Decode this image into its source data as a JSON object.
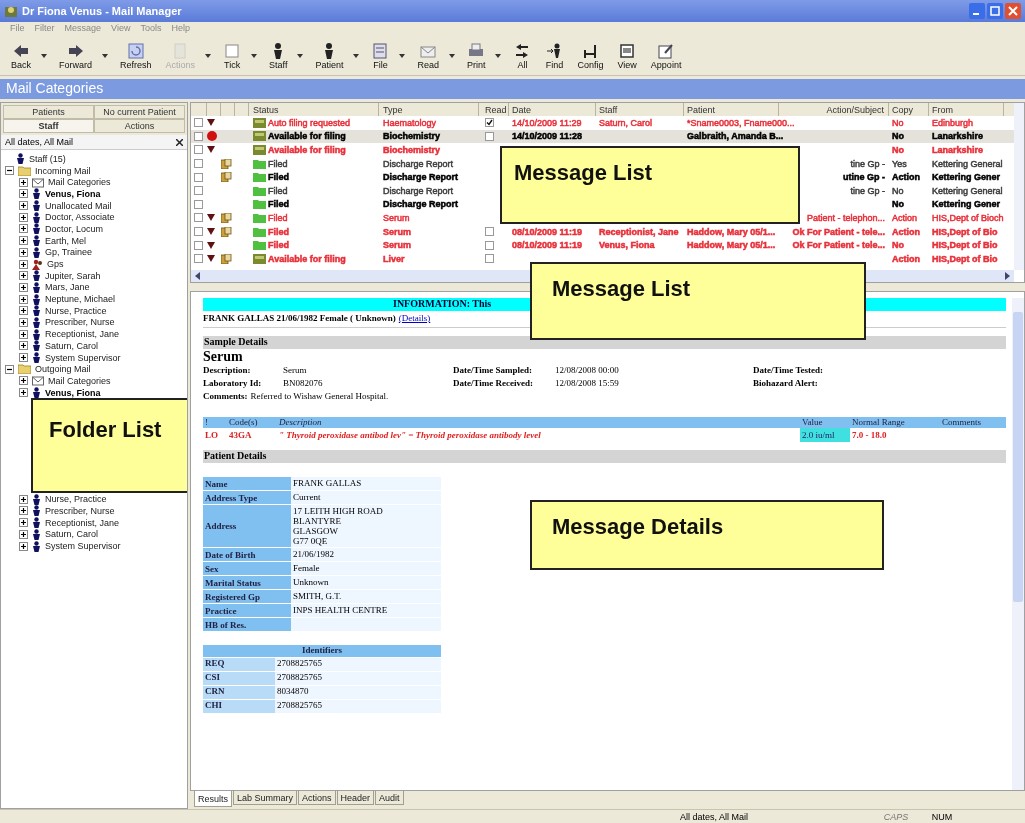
{
  "window": {
    "title": "Dr Fiona Venus - Mail Manager"
  },
  "menu": [
    "File",
    "Filter",
    "Message",
    "View",
    "Tools",
    "Help"
  ],
  "toolbar": [
    {
      "label": "Back",
      "kind": "back",
      "dropdown": true,
      "disabled": false
    },
    {
      "label": "Forward",
      "kind": "forward",
      "dropdown": true,
      "disabled": false
    },
    {
      "label": "Refresh",
      "kind": "refresh",
      "dropdown": false,
      "disabled": false
    },
    {
      "label": "Actions",
      "kind": "actions",
      "dropdown": true,
      "disabled": true
    },
    {
      "label": "Tick",
      "kind": "tick",
      "dropdown": true,
      "disabled": false
    },
    {
      "label": "Staff",
      "kind": "person",
      "dropdown": true,
      "disabled": false
    },
    {
      "label": "Patient",
      "kind": "person",
      "dropdown": true,
      "disabled": false
    },
    {
      "label": "File",
      "kind": "file",
      "dropdown": true,
      "disabled": false
    },
    {
      "label": "Read",
      "kind": "read",
      "dropdown": true,
      "disabled": false
    },
    {
      "label": "Print",
      "kind": "print",
      "dropdown": true,
      "disabled": false
    },
    {
      "label": "All",
      "kind": "all",
      "dropdown": false,
      "disabled": false
    },
    {
      "label": "Find",
      "kind": "find",
      "dropdown": false,
      "disabled": false
    },
    {
      "label": "Config",
      "kind": "config",
      "dropdown": false,
      "disabled": false
    },
    {
      "label": "View",
      "kind": "view",
      "dropdown": false,
      "disabled": false
    },
    {
      "label": "Appoint",
      "kind": "appoint",
      "dropdown": false,
      "disabled": false
    }
  ],
  "section_title": "Mail Categories",
  "sidebar": {
    "tabs": [
      {
        "label": "Patients",
        "selected": false
      },
      {
        "label": "No current Patient",
        "selected": false
      },
      {
        "label": "Staff",
        "selected": true
      },
      {
        "label": "Actions",
        "selected": false
      }
    ],
    "filter": "All dates, All Mail",
    "tree": [
      {
        "label": "Staff (15)",
        "kind": "person",
        "current": false
      },
      {
        "label": "Incoming Mail",
        "kind": "mailbox",
        "current": false,
        "expanded": true,
        "children": [
          {
            "label": "Mail Categories",
            "kind": "category",
            "current": false,
            "expanded": false
          },
          {
            "label": "Venus, Fiona",
            "kind": "person",
            "current": true,
            "expanded": false
          },
          {
            "label": "Unallocated Mail",
            "kind": "person",
            "current": false,
            "expanded": false
          },
          {
            "label": "Doctor, Associate",
            "kind": "person",
            "current": false,
            "expanded": false
          },
          {
            "label": "Doctor, Locum",
            "kind": "person",
            "current": false,
            "expanded": false
          },
          {
            "label": "Earth, Mel",
            "kind": "person",
            "current": false,
            "expanded": false
          },
          {
            "label": "Gp, Trainee",
            "kind": "person",
            "current": false,
            "expanded": false
          },
          {
            "label": "Gps",
            "kind": "group",
            "current": false,
            "expanded": false
          },
          {
            "label": "Jupiter, Sarah",
            "kind": "person",
            "current": false,
            "expanded": false
          },
          {
            "label": "Mars, Jane",
            "kind": "person",
            "current": false,
            "expanded": false
          },
          {
            "label": "Neptune, Michael",
            "kind": "person",
            "current": false,
            "expanded": false
          },
          {
            "label": "Nurse, Practice",
            "kind": "person",
            "current": false,
            "expanded": false
          },
          {
            "label": "Prescriber, Nurse",
            "kind": "person",
            "current": false,
            "expanded": false
          },
          {
            "label": "Receptionist, Jane",
            "kind": "person",
            "current": false,
            "expanded": false
          },
          {
            "label": "Saturn, Carol",
            "kind": "person",
            "current": false,
            "expanded": false
          },
          {
            "label": "System Supervisor",
            "kind": "person",
            "current": false,
            "expanded": false
          }
        ]
      },
      {
        "label": "Outgoing Mail",
        "kind": "mailbox",
        "current": false,
        "expanded": true,
        "children": [
          {
            "label": "Mail Categories",
            "kind": "category",
            "current": false,
            "expanded": false
          },
          {
            "label": "Venus, Fiona",
            "kind": "person",
            "current": true,
            "expanded": false
          },
          {
            "label": "Folder List",
            "kind": "callout"
          },
          {
            "label": "Nurse, Practice",
            "kind": "person",
            "current": false,
            "expanded": false
          },
          {
            "label": "Prescriber, Nurse",
            "kind": "person",
            "current": false,
            "expanded": false
          },
          {
            "label": "Receptionist, Jane",
            "kind": "person",
            "current": false,
            "expanded": false
          },
          {
            "label": "Saturn, Carol",
            "kind": "person",
            "current": false,
            "expanded": false
          },
          {
            "label": "System Supervisor",
            "kind": "person",
            "current": false,
            "expanded": false
          }
        ]
      }
    ]
  },
  "message_list": {
    "columns": [
      "Status",
      "Type",
      "Read",
      "Date",
      "Staff",
      "Patient",
      "Action/Subject",
      "Copy",
      "From"
    ],
    "rows": [
      {
        "flagged": true,
        "alert": false,
        "attachment": false,
        "filed": false,
        "unread": false,
        "selected": false,
        "color": "#e8303a",
        "status": "Auto filing requested",
        "type": "Haematology",
        "read": true,
        "date": "14/10/2009 11:29",
        "staff": "Saturn, Carol",
        "patient": "*Sname0003, Fname000...",
        "copy": "No",
        "from": "Edinburgh"
      },
      {
        "flagged": false,
        "alert": true,
        "attachment": false,
        "filed": false,
        "unread": true,
        "selected": true,
        "color": "#000000",
        "status": "Available for filing",
        "type": "Biochemistry",
        "read": false,
        "date": "14/10/2009 11:28",
        "patient": "Galbraith, Amanda B...",
        "copy": "No",
        "from": "Lanarkshire"
      },
      {
        "flagged": true,
        "alert": false,
        "attachment": false,
        "filed": false,
        "unread": true,
        "selected": false,
        "color": "#e8303a",
        "status": "Available for filing",
        "type": "Biochemistry",
        "copy": "No",
        "from": "Lanarkshire"
      },
      {
        "flagged": false,
        "alert": false,
        "attachment": true,
        "filed": true,
        "unread": false,
        "selected": false,
        "color": "#404040",
        "status": "Filed",
        "type": "Discharge Report",
        "action": "tine Gp -",
        "copy": "Yes",
        "from": "Kettering General"
      },
      {
        "flagged": false,
        "alert": false,
        "attachment": true,
        "filed": true,
        "unread": true,
        "selected": false,
        "color": "#000000",
        "status": "Filed",
        "type": "Discharge Report",
        "action": "utine Gp -",
        "copy": "Action",
        "from": "Kettering Gener"
      },
      {
        "flagged": false,
        "alert": false,
        "attachment": false,
        "filed": true,
        "unread": false,
        "selected": false,
        "color": "#404040",
        "status": "Filed",
        "type": "Discharge Report",
        "action": "tine Gp -",
        "copy": "No",
        "from": "Kettering General"
      },
      {
        "flagged": false,
        "alert": false,
        "attachment": false,
        "filed": true,
        "unread": true,
        "selected": false,
        "color": "#000000",
        "status": "Filed",
        "type": "Discharge Report",
        "copy": "No",
        "from": "Kettering Gener"
      },
      {
        "flagged": true,
        "alert": false,
        "attachment": true,
        "filed": true,
        "unread": false,
        "selected": false,
        "color": "#e8303a",
        "status": "Filed",
        "type": "Serum",
        "action": "Patient - telephon...",
        "copy": "Action",
        "from": "HIS,Dept of Bioch"
      },
      {
        "flagged": true,
        "alert": false,
        "attachment": true,
        "filed": true,
        "unread": true,
        "selected": false,
        "color": "#e8303a",
        "status": "Filed",
        "type": "Serum",
        "read": false,
        "date": "08/10/2009 11:19",
        "staff": "Receptionist, Jane",
        "patient": "Haddow, Mary 05/1...",
        "action": "Ok For Patient - tele...",
        "copy": "Action",
        "from": "HIS,Dept of Bio"
      },
      {
        "flagged": true,
        "alert": false,
        "attachment": false,
        "filed": true,
        "unread": true,
        "selected": false,
        "color": "#e8303a",
        "status": "Filed",
        "type": "Serum",
        "read": false,
        "date": "08/10/2009 11:19",
        "staff": "Venus, Fiona",
        "patient": "Haddow, Mary 05/1...",
        "action": "Ok For Patient - tele...",
        "copy": "No",
        "from": "HIS,Dept of Bio"
      },
      {
        "flagged": true,
        "alert": false,
        "attachment": true,
        "filed": false,
        "unread": true,
        "selected": false,
        "color": "#e8303a",
        "status": "Available for filing",
        "type": "Liver",
        "read": false,
        "copy": "Action",
        "from": "HIS,Dept of Bio"
      }
    ]
  },
  "callouts": [
    "Message List",
    "Message List",
    "Message Details"
  ],
  "details": {
    "banner": "INFORMATION: This",
    "patient_line": "FRANK GALLAS 21/06/1982 Female  ( Unknown)",
    "details_link": "(Details)",
    "sample_heading": "Sample Details",
    "sample_type": "Serum",
    "sample_fields": [
      {
        "label": "Description:",
        "value": "Serum"
      },
      {
        "label": "Date/Time Sampled:",
        "value": "12/08/2008 00:00"
      },
      {
        "label": "Date/Time Tested:"
      },
      {
        "label": "Laboratory Id:",
        "value": "BN082076"
      },
      {
        "label": "Date/Time Received:",
        "value": "12/08/2008 15:59"
      },
      {
        "label": "Biohazard Alert:"
      }
    ],
    "comments_label": "Comments:",
    "comments": "Referred to Wishaw General Hospital.",
    "results": {
      "columns": [
        "!",
        "Code(s)",
        "Description",
        "Value",
        "Normal Range",
        "Comments"
      ],
      "rows": [
        {
          "flag": "LO",
          "code": "43GA",
          "description": "\" Thyroid peroxidase antibod lev\" = Thyroid peroxidase antibody level",
          "value": "2.0 iu/ml",
          "range": "7.0 - 18.0"
        }
      ]
    },
    "patient_heading": "Patient Details",
    "patient_fields": [
      {
        "label": "Name",
        "lines": [
          "FRANK GALLAS"
        ]
      },
      {
        "label": "Address Type",
        "lines": [
          "Current"
        ]
      },
      {
        "label": "Address",
        "lines": [
          "17 LEITH HIGH ROAD",
          "BLANTYRE",
          "GLASGOW",
          "G77 0QE"
        ]
      },
      {
        "label": "Date of Birth",
        "lines": [
          "21/06/1982"
        ]
      },
      {
        "label": "Sex",
        "lines": [
          "Female"
        ]
      },
      {
        "label": "Marital Status",
        "lines": [
          "Unknown"
        ]
      },
      {
        "label": "Registered Gp",
        "lines": [
          "SMITH, G.T."
        ]
      },
      {
        "label": "Practice",
        "lines": [
          "INPS HEALTH CENTRE"
        ]
      },
      {
        "label": "HB of Res."
      }
    ],
    "identifiers_heading": "Identifiers",
    "identifiers": [
      {
        "label": "REQ",
        "value": "2708825765"
      },
      {
        "label": "CSI",
        "value": "2708825765"
      },
      {
        "label": "CRN",
        "value": "8034870"
      },
      {
        "label": "CHI",
        "value": "2708825765"
      }
    ]
  },
  "bottom_tabs": [
    {
      "label": "Results",
      "selected": true
    },
    {
      "label": "Lab Summary",
      "selected": false
    },
    {
      "label": "Actions",
      "selected": false
    },
    {
      "label": "Header",
      "selected": false
    },
    {
      "label": "Audit",
      "selected": false
    }
  ],
  "status_bar": {
    "filter": "All dates, All Mail",
    "caps": "CAPS",
    "caps_on": false,
    "num": "NUM"
  }
}
